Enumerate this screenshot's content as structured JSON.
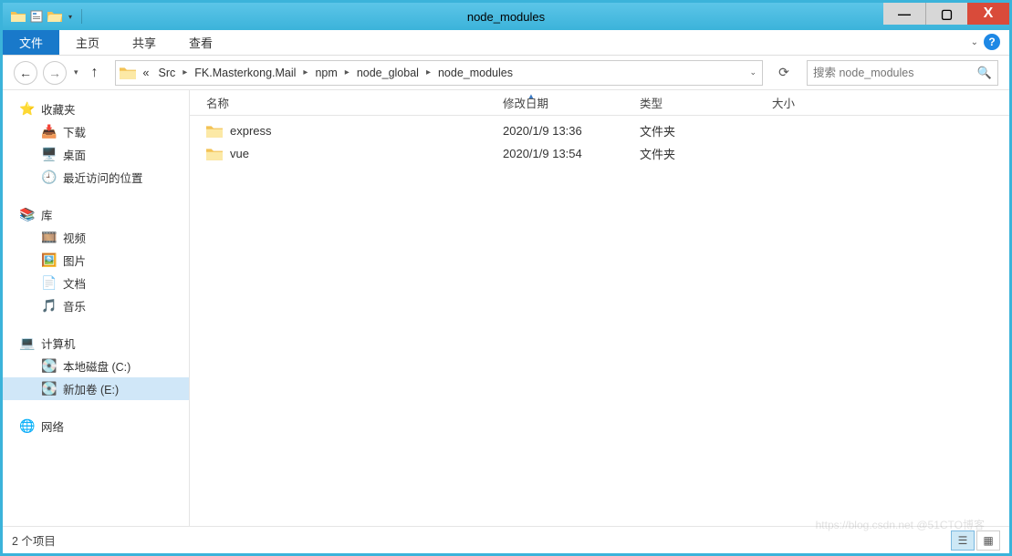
{
  "window": {
    "title": "node_modules"
  },
  "ribbon": {
    "file": "文件",
    "home": "主页",
    "share": "共享",
    "view": "查看"
  },
  "breadcrumb": {
    "prefix": "«",
    "items": [
      "Src",
      "FK.Masterkong.Mail",
      "npm",
      "node_global",
      "node_modules"
    ]
  },
  "search": {
    "placeholder": "搜索 node_modules"
  },
  "sidebar": {
    "favorites": {
      "label": "收藏夹",
      "items": [
        "下载",
        "桌面",
        "最近访问的位置"
      ]
    },
    "libraries": {
      "label": "库",
      "items": [
        "视频",
        "图片",
        "文档",
        "音乐"
      ]
    },
    "computer": {
      "label": "计算机",
      "items": [
        "本地磁盘 (C:)",
        "新加卷 (E:)"
      ],
      "selected": 1
    },
    "network": {
      "label": "网络"
    }
  },
  "columns": {
    "name": "名称",
    "date": "修改日期",
    "type": "类型",
    "size": "大小"
  },
  "files": [
    {
      "name": "express",
      "date": "2020/1/9 13:36",
      "type": "文件夹",
      "size": ""
    },
    {
      "name": "vue",
      "date": "2020/1/9 13:54",
      "type": "文件夹",
      "size": ""
    }
  ],
  "status": {
    "count": "2 个项目"
  },
  "watermark": "https://blog.csdn.net @51CTO博客"
}
